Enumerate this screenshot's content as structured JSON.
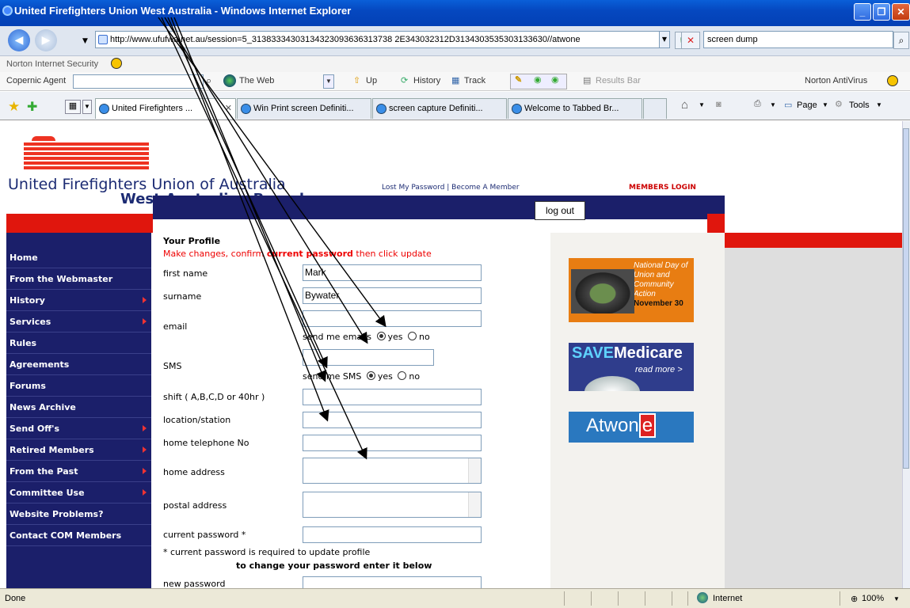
{
  "window": {
    "title": "United Firefighters Union West Australia - Windows Internet Explorer"
  },
  "address": {
    "url": "http://www.ufufwa.net.au/session=5_31383334303134323093636313738 2E343032312D3134303535303133630//atwone",
    "search_value": "screen dump"
  },
  "toolbar1": {
    "norton": "Norton Internet Security"
  },
  "toolbar2": {
    "copernic": "Copernic Agent",
    "the_web": "The Web",
    "up": "Up",
    "history": "History",
    "track": "Track",
    "results": "Results Bar",
    "antivirus": "Norton AntiVirus"
  },
  "tabs": [
    {
      "label": "United Firefighters ..."
    },
    {
      "label": "Win Print screen Definiti..."
    },
    {
      "label": "screen capture Definiti..."
    },
    {
      "label": "Welcome to Tabbed Br..."
    }
  ],
  "cmdbar": {
    "page": "Page",
    "tools": "Tools"
  },
  "site": {
    "brand_line1": "United Firefighters Union of Australia",
    "brand_line2": "West Australian Branch",
    "links": "Lost My Password  |  Become A Member",
    "members_login": "MEMBERS LOGIN",
    "logout": "log out"
  },
  "nav": [
    {
      "label": "Home",
      "sub": false
    },
    {
      "label": "From the Webmaster",
      "sub": false
    },
    {
      "label": "History",
      "sub": true
    },
    {
      "label": "Services",
      "sub": true
    },
    {
      "label": "Rules",
      "sub": false
    },
    {
      "label": "Agreements",
      "sub": false
    },
    {
      "label": "Forums",
      "sub": false
    },
    {
      "label": "News Archive",
      "sub": false
    },
    {
      "label": "Send Off's",
      "sub": true
    },
    {
      "label": "Retired Members",
      "sub": true
    },
    {
      "label": "From the Past",
      "sub": true
    },
    {
      "label": "Committee Use",
      "sub": true
    },
    {
      "label": "Website Problems?",
      "sub": false
    },
    {
      "label": "Contact COM Members",
      "sub": false
    }
  ],
  "form": {
    "heading": "Your Profile",
    "sub_pre": "Make changes, confirm ",
    "sub_bold": "current password",
    "sub_post": " then click update",
    "first_name_label": "first name",
    "first_name": "Mark",
    "surname_label": "surname",
    "surname": "Bywater",
    "email_label": "email",
    "send_emails": "send me emails",
    "sms_label": "SMS",
    "send_sms": "send me SMS",
    "yes": "yes",
    "no": "no",
    "shift_label": "shift ( A,B,C,D or 40hr )",
    "location_label": "location/station",
    "home_phone_label": "home telephone No",
    "home_address_label": "home address",
    "postal_address_label": "postal address",
    "current_password_label": "current password *",
    "note1": "* current password is required to update profile",
    "note2": "to change your password enter it below",
    "new_password_label": "new password"
  },
  "ads": {
    "ad1": "National Day of Union and Community Action",
    "ad1_date": "November 30",
    "ad2_save": "SAVE",
    "ad2_medicare": "Medicare",
    "ad2_more": "read more >",
    "ad3_pre": "Atwon",
    "ad3_e": "e"
  },
  "status": {
    "left": "Done",
    "zone": "Internet",
    "zoom": "100%"
  }
}
